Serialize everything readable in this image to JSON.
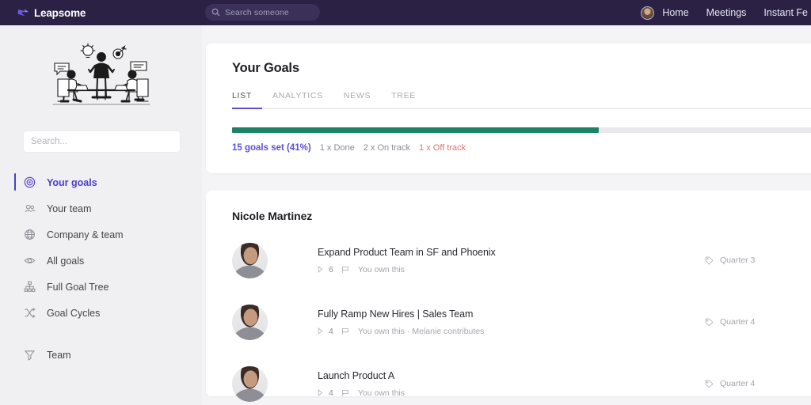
{
  "topbar": {
    "brand": "Leapsome",
    "logo_icon": "leapsome-arrow-icon",
    "search": {
      "placeholder": "Search someone",
      "value": "",
      "icon": "search-icon"
    },
    "nav": [
      {
        "label": "Home",
        "name": "home"
      },
      {
        "label": "Meetings",
        "name": "meetings"
      },
      {
        "label": "Instant Fe",
        "name": "instant-feedback"
      }
    ],
    "avatar_icon": "user-avatar"
  },
  "sidebar": {
    "illustration": "team-meeting-illustration",
    "search": {
      "placeholder": "Search...",
      "value": ""
    },
    "items": [
      {
        "label": "Your goals",
        "icon": "target-icon",
        "active": true
      },
      {
        "label": "Your team",
        "icon": "people-icon",
        "active": false
      },
      {
        "label": "Company & team",
        "icon": "globe-icon",
        "active": false
      },
      {
        "label": "All goals",
        "icon": "eye-icon",
        "active": false
      },
      {
        "label": "Full Goal Tree",
        "icon": "tree-icon",
        "active": false
      },
      {
        "label": "Goal Cycles",
        "icon": "shuffle-icon",
        "active": false
      }
    ],
    "footer_items": [
      {
        "label": "Team",
        "icon": "filter-icon"
      }
    ]
  },
  "main": {
    "page_title": "Your Goals",
    "tabs": [
      {
        "label": "LIST",
        "active": true
      },
      {
        "label": "ANALYTICS",
        "active": false
      },
      {
        "label": "NEWS",
        "active": false
      },
      {
        "label": "TREE",
        "active": false
      }
    ],
    "progress": {
      "percent": 62,
      "fill_color": "#1e8266",
      "track_color": "#e9e9eb"
    },
    "stats": {
      "summary": "15 goals set (41%)",
      "done": "1 x Done",
      "on_track": "2 x On track",
      "off_track": "1 x Off track"
    },
    "owner": "Nicole Martinez",
    "goals": [
      {
        "title": "Expand Product Team in SF and Phoenix",
        "count": "6",
        "ownership": "You own this",
        "tag": "Quarter 3",
        "tag_icon": "tag-icon",
        "expand_icon": "triangle-right-icon",
        "flag_icon": "flag-icon",
        "avatar_icon": "user-avatar"
      },
      {
        "title": "Fully Ramp New Hires | Sales Team",
        "count": "4",
        "ownership": "You own this · Melanie contributes",
        "tag": "Quarter 4",
        "tag_icon": "tag-icon",
        "expand_icon": "triangle-right-icon",
        "flag_icon": "flag-icon",
        "avatar_icon": "user-avatar"
      },
      {
        "title": "Launch Product A",
        "count": "4",
        "ownership": "You own this",
        "tag": "Quarter 4",
        "tag_icon": "tag-icon",
        "expand_icon": "triangle-right-icon",
        "flag_icon": "flag-icon",
        "avatar_icon": "user-avatar"
      }
    ]
  },
  "colors": {
    "topbar_bg": "#2a2145",
    "accent_purple": "#5b4fd6",
    "progress_green": "#1e8266",
    "off_track_red": "#e0736f",
    "page_bg": "#f4f4f6",
    "sidebar_bg": "#f0f0f2"
  }
}
